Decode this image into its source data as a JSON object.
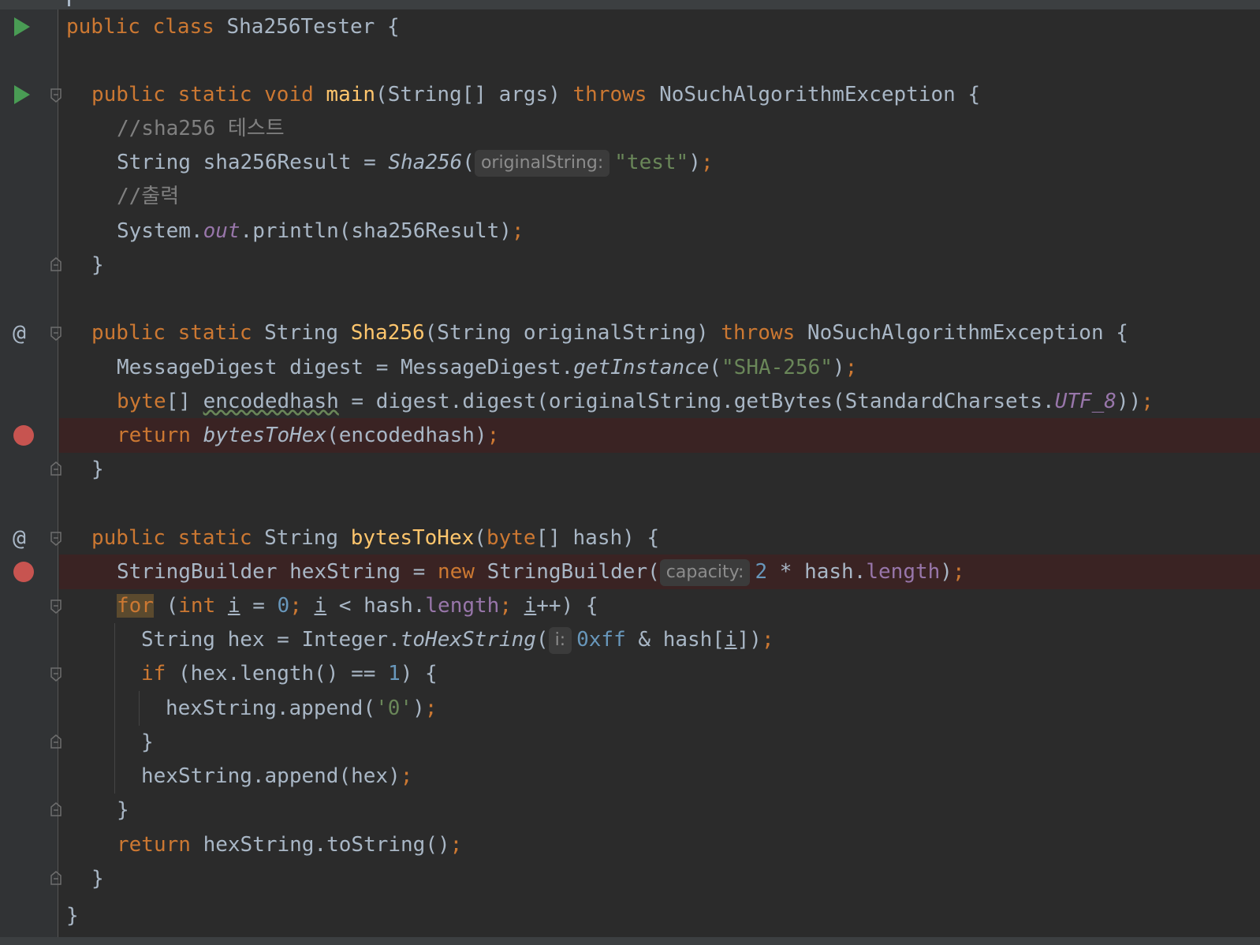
{
  "colors": {
    "background": "#2b2b2b",
    "gutter": "#313335",
    "keyword": "#cc7832",
    "method": "#ffc66d",
    "field": "#9876aa",
    "string": "#6a8759",
    "number": "#6897bb",
    "comment": "#808080",
    "breakpoint": "#c75450",
    "run_icon": "#499c54"
  },
  "code": {
    "class_decl": {
      "kw": "public class",
      "name": "Sha256Tester",
      "brace": "{"
    },
    "main_decl": {
      "mods": "public static void",
      "name": "main",
      "params": "(String[] args)",
      "throws": "throws",
      "exc": "NoSuchAlgorithmException",
      "brace": "{"
    },
    "comment1": "//sha256 테스트",
    "line_result": {
      "pre": "String sha256Result = ",
      "call": "Sha256",
      "open": "(",
      "hint": "originalString:",
      "arg": "\"test\"",
      "close": ")",
      "semi": ";"
    },
    "comment2": "//출력",
    "line_print": {
      "pre": "System.",
      "field": "out",
      "post": ".println(sha256Result)",
      "semi": ";"
    },
    "close_brace": "}",
    "sha_decl": {
      "mods": "public static",
      "type": "String",
      "name": "Sha256",
      "params": "(String originalString)",
      "throws": "throws",
      "exc": "NoSuchAlgorithmException",
      "brace": "{"
    },
    "line_digest": {
      "pre": "MessageDigest digest = MessageDigest.",
      "call": "getInstance",
      "open": "(",
      "arg": "\"SHA-256\"",
      "close": ")",
      "semi": ";"
    },
    "line_encoded": {
      "kw": "byte",
      "bracket": "[] ",
      "var": "encodedhash",
      "mid": " = digest.digest(originalString.getBytes(StandardCharsets.",
      "field": "UTF_8",
      "close": "))",
      "semi": ";"
    },
    "line_return_hex": {
      "kw": "return",
      "call": "bytesToHex",
      "args": "(encodedhash)",
      "semi": ";"
    },
    "hex_decl": {
      "mods": "public static",
      "type": "String",
      "name": "bytesToHex",
      "open": "(",
      "kw": "byte",
      "rest": "[] hash) {"
    },
    "line_sb": {
      "pre": "StringBuilder hexString = ",
      "kw": "new",
      "type": " StringBuilder(",
      "hint": "capacity:",
      "num": "2",
      "mid": " * hash.",
      "field": "length",
      "close": ")",
      "semi": ";"
    },
    "line_for": {
      "kw": "for",
      "open": " (",
      "kw_int": "int",
      "sp": " ",
      "i1": "i",
      "eq": " = ",
      "zero": "0",
      "semi1": ";",
      "sp2": " ",
      "i2": "i",
      "lt": " < hash.",
      "field": "length",
      "semi2": ";",
      "sp3": " ",
      "i3": "i",
      "inc": "++) {"
    },
    "line_hex": {
      "pre": "String hex = Integer.",
      "call": "toHexString",
      "open": "(",
      "hint": "i:",
      "num": "0xff",
      "mid": " & hash[",
      "idx": "i",
      "close": "])",
      "semi": ";"
    },
    "line_if": {
      "kw": "if",
      "pre": " (hex.length() == ",
      "num": "1",
      "post": ") {"
    },
    "line_append0": {
      "pre": "hexString.append(",
      "str": "'0'",
      "close": ")",
      "semi": ";"
    },
    "line_append_hex": {
      "pre": "hexString.append(hex)",
      "semi": ";"
    },
    "line_return_sb": {
      "kw": "return",
      "pre": " hexString.toString()",
      "semi": ";"
    }
  }
}
